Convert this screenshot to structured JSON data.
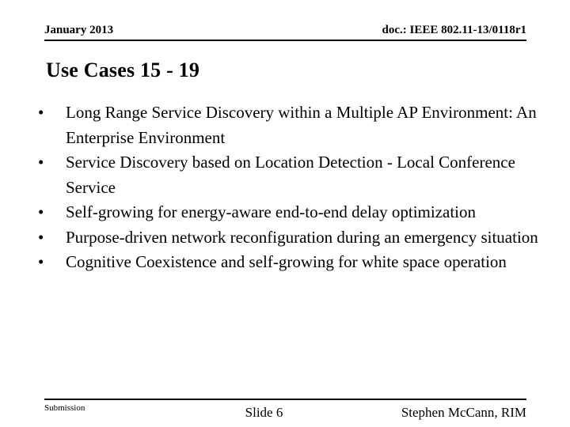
{
  "slide": {
    "background_color": "#ffffff",
    "text_color": "#000000",
    "header": {
      "date": "January 2013",
      "doc_number": "doc.: IEEE 802.11-13/0118r1"
    },
    "title": "Use Cases 15 - 19",
    "bullets": [
      {
        "marker": "•",
        "text": "Long Range Service Discovery within a Multiple AP Environment: An Enterprise Environment"
      },
      {
        "marker": "•",
        "text": "Service Discovery based on Location Detection - Local Conference Service"
      },
      {
        "marker": "•",
        "text": "Self-growing for energy-aware end-to-end delay optimization"
      },
      {
        "marker": "•",
        "text": "Purpose-driven network reconfiguration during an emergency situation"
      },
      {
        "marker": "•",
        "text": "Cognitive Coexistence and self-growing for white space operation"
      }
    ],
    "footer": {
      "submission": "Submission",
      "slide_number": "Slide 6",
      "author": "Stephen McCann, RIM"
    }
  }
}
